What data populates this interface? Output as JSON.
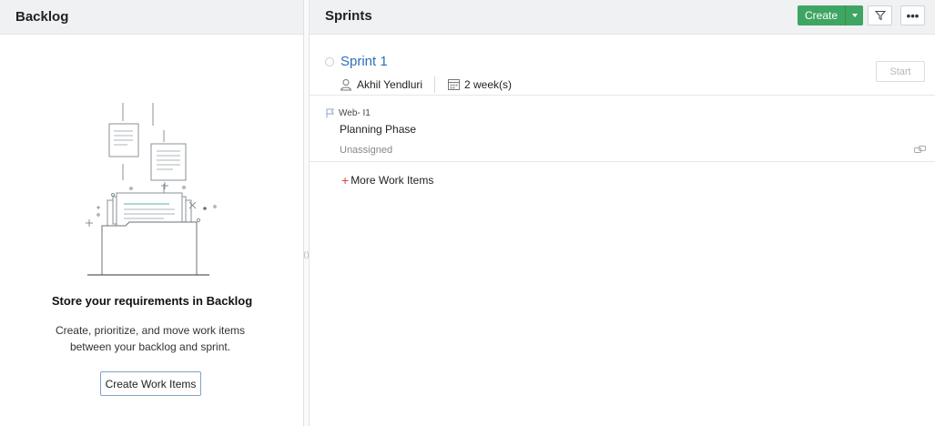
{
  "backlog": {
    "title": "Backlog",
    "empty_title": "Store your requirements in Backlog",
    "empty_description": "Create, prioritize, and move work items between your backlog and sprint.",
    "create_button": "Create Work Items"
  },
  "sprints": {
    "title": "Sprints",
    "create_label": "Create",
    "more_label": "•••",
    "sprint": {
      "name": "Sprint 1",
      "owner": "Akhil Yendluri",
      "duration": "2 week(s)",
      "start_label": "Start"
    },
    "work_item": {
      "id": "Web- I1",
      "title": "Planning Phase",
      "assignee": "Unassigned"
    },
    "more_items_label": "More Work Items"
  },
  "colors": {
    "accent_green": "#3fa563",
    "link_blue": "#2f6fb5",
    "plus_red": "#d64545"
  },
  "icons": [
    "filter-icon",
    "more-icon",
    "user-icon",
    "calendar-icon",
    "flag-icon",
    "link-icon",
    "dropdown-caret-icon"
  ]
}
